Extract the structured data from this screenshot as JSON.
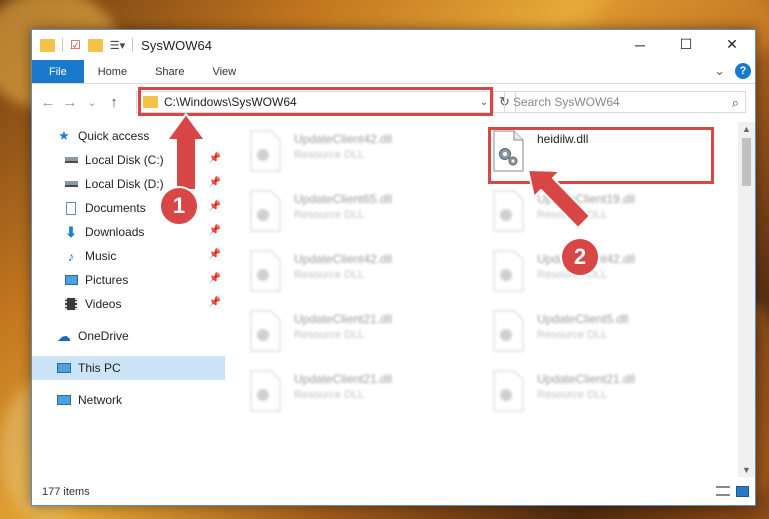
{
  "window": {
    "title": "SysWOW64"
  },
  "window_controls": {
    "minimize": "─",
    "maximize": "☐",
    "close": "✕"
  },
  "ribbon": {
    "tabs": [
      "File",
      "Home",
      "Share",
      "View"
    ],
    "expand": "⌄",
    "help": "?"
  },
  "nav": {
    "back": "←",
    "forward": "→",
    "recent": "⌄",
    "up": "↑"
  },
  "address": {
    "path": "C:\\Windows\\SysWOW64",
    "dropdown": "⌄",
    "refresh": "↻"
  },
  "search": {
    "placeholder": "Search SysWOW64",
    "icon": "⌕"
  },
  "sidebar": {
    "quick_access": "Quick access",
    "items": [
      {
        "label": "Local Disk (C:)",
        "icon": "drive-icon",
        "pinned": true
      },
      {
        "label": "Local Disk (D:)",
        "icon": "drive-icon",
        "pinned": true
      },
      {
        "label": "Documents",
        "icon": "documents-icon",
        "pinned": true
      },
      {
        "label": "Downloads",
        "icon": "downloads-icon",
        "pinned": true
      },
      {
        "label": "Music",
        "icon": "music-icon",
        "pinned": true
      },
      {
        "label": "Pictures",
        "icon": "pictures-icon",
        "pinned": true
      },
      {
        "label": "Videos",
        "icon": "videos-icon",
        "pinned": true
      }
    ],
    "onedrive": "OneDrive",
    "this_pc": "This PC",
    "network": "Network"
  },
  "files": [
    {
      "name": "UpdateClient42.dll",
      "type": "Resource DLL",
      "blurred": true
    },
    {
      "name": "heidilw.dll",
      "type": "",
      "blurred": false
    },
    {
      "name": "UpdateClient65.dll",
      "type": "Resource DLL",
      "blurred": true
    },
    {
      "name": "UpdateClient19.dll",
      "type": "Resource DLL",
      "blurred": true
    },
    {
      "name": "UpdateClient42.dll",
      "type": "Resource DLL",
      "blurred": true
    },
    {
      "name": "UpdateClient42.dll",
      "type": "Resource DLL",
      "blurred": true
    },
    {
      "name": "UpdateClient21.dll",
      "type": "Resource DLL",
      "blurred": true
    },
    {
      "name": "UpdateClient5.dll",
      "type": "Resource DLL",
      "blurred": true
    },
    {
      "name": "UpdateClient21.dll",
      "type": "Resource DLL",
      "blurred": true
    },
    {
      "name": "UpdateClient21.dll",
      "type": "Resource DLL",
      "blurred": true
    }
  ],
  "status": {
    "count": "177 items"
  },
  "annotations": {
    "step1": "1",
    "step2": "2",
    "color": "#d94646"
  }
}
